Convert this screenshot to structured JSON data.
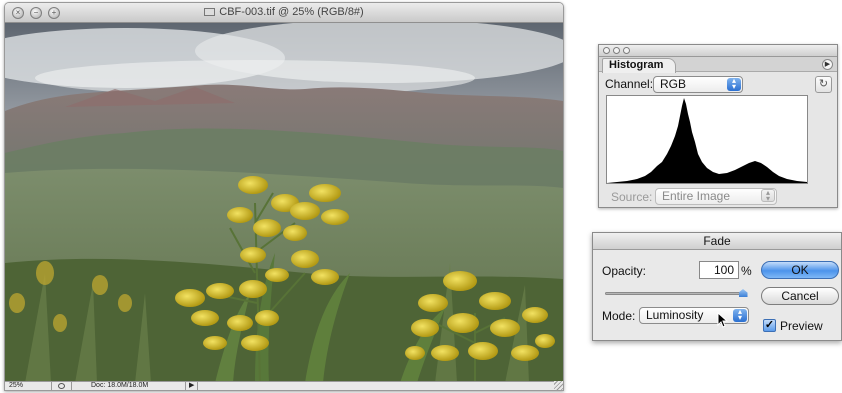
{
  "document_window": {
    "title": "CBF-003.tif @ 25% (RGB/8#)",
    "status": {
      "zoom": "25%",
      "doc_size": "Doc: 18.0M/18.0M"
    },
    "icons": [
      "close-icon",
      "minimize-icon",
      "zoom-icon",
      "file-icon",
      "navigator-icon",
      "status-menu-arrow-icon",
      "resize-grip-icon"
    ]
  },
  "histogram_palette": {
    "tab_label": "Histogram",
    "channel_label": "Channel:",
    "channel_value": "RGB",
    "source_label": "Source:",
    "source_value": "Entire Image"
  },
  "fade_dialog": {
    "title": "Fade",
    "opacity_label": "Opacity:",
    "opacity_value": "100",
    "opacity_unit": "%",
    "opacity_level": 1.0,
    "mode_label": "Mode:",
    "mode_value": "Luminosity",
    "ok_label": "OK",
    "cancel_label": "Cancel",
    "preview_label": "Preview",
    "preview_checked": true
  },
  "colors": {
    "default_button": "#4c93eb",
    "flower_yellow": "#d8c020",
    "foliage_green": "#5f7f3c"
  }
}
